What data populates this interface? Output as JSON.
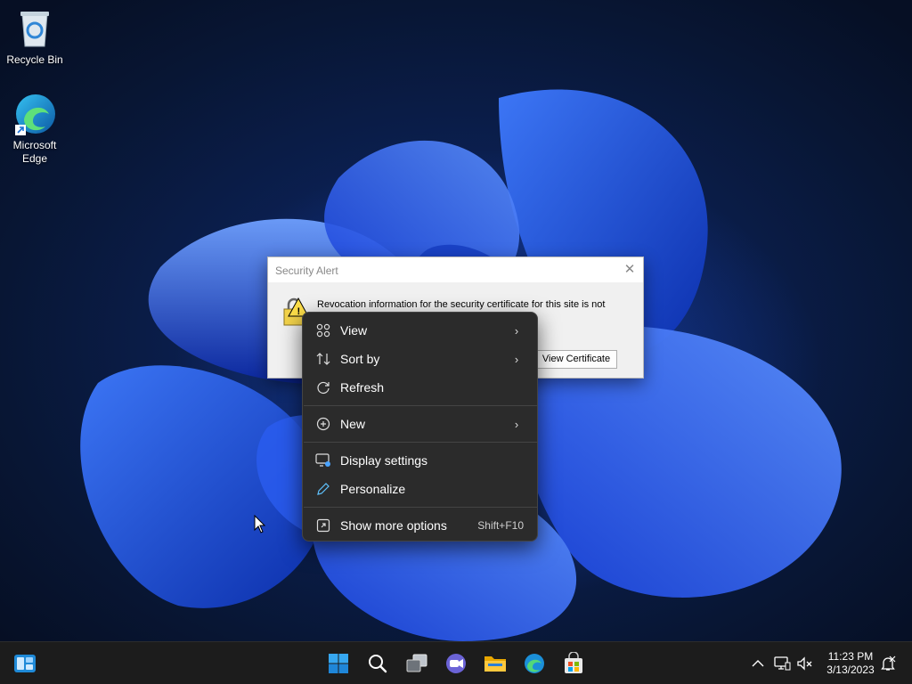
{
  "desktop": {
    "icons": [
      {
        "label": "Recycle Bin"
      },
      {
        "label": "Microsoft Edge"
      }
    ]
  },
  "dialog": {
    "title": "Security Alert",
    "message": "Revocation information for the security certificate for this site is not",
    "view_certificate_label": "View Certificate",
    "close_glyph": "✕"
  },
  "context_menu": {
    "items": [
      {
        "label": "View",
        "icon": "view-grid-icon",
        "submenu": true
      },
      {
        "label": "Sort by",
        "icon": "sort-icon",
        "submenu": true
      },
      {
        "label": "Refresh",
        "icon": "refresh-icon",
        "submenu": false
      },
      {
        "label": "New",
        "icon": "new-plus-icon",
        "submenu": true
      },
      {
        "label": "Display settings",
        "icon": "display-settings-icon",
        "submenu": false
      },
      {
        "label": "Personalize",
        "icon": "pen-icon",
        "submenu": false
      },
      {
        "label": "Show more options",
        "icon": "show-more-icon",
        "shortcut": "Shift+F10"
      }
    ]
  },
  "taskbar": {
    "apps": [
      "widgets",
      "start",
      "search",
      "task-view",
      "chat",
      "file-explorer",
      "edge",
      "store"
    ],
    "clock": {
      "time": "11:23 PM",
      "date": "3/13/2023"
    }
  },
  "colors": {
    "menu_bg": "#2b2b2b",
    "taskbar_bg": "#1c1c1c",
    "accent": "#0078d4"
  }
}
